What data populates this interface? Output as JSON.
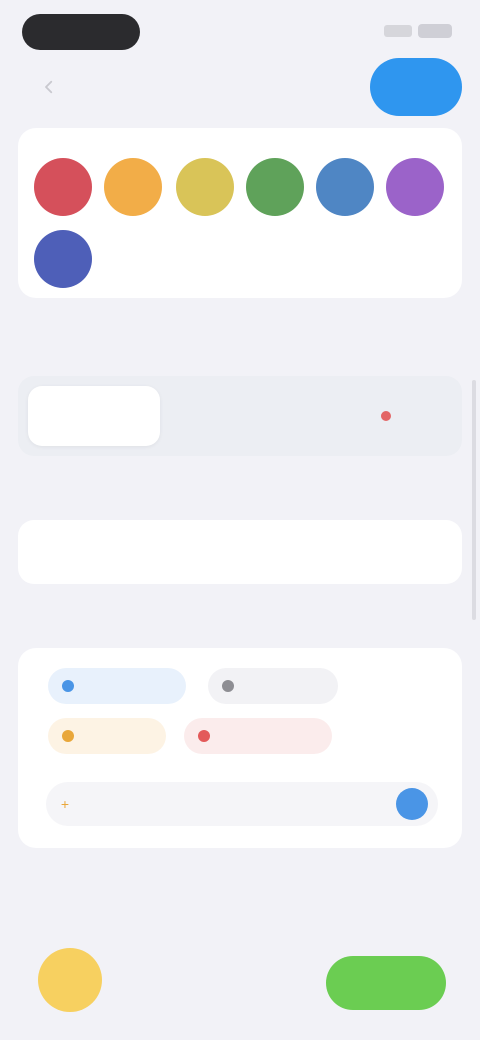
{
  "status": {
    "time": ""
  },
  "nav": {
    "title": "",
    "back_icon": "chevron-left-icon",
    "done_label": ""
  },
  "colors": {
    "label": "",
    "swatches": [
      "#d5505b",
      "#f2ad48",
      "#d9c458",
      "#5fa25a",
      "#4f86c4",
      "#9b63c9",
      "#4e5fb8"
    ]
  },
  "view_mode": {
    "label": "",
    "options": [
      "",
      "",
      ""
    ],
    "active_index": 0
  },
  "notes": {
    "label": "",
    "title": "",
    "placeholder": "",
    "counter": ""
  },
  "tags": {
    "label": "",
    "items": [
      {
        "text": "",
        "color": "#4a95e6"
      },
      {
        "text": "",
        "color": "#8e8e93"
      },
      {
        "text": "",
        "color": "#e9a73a"
      },
      {
        "text": "",
        "color": "#e35a5a"
      }
    ],
    "add_placeholder": ""
  },
  "bottom": {
    "label": "",
    "line1": "",
    "line2": "",
    "line3": "",
    "cta_label": ""
  }
}
